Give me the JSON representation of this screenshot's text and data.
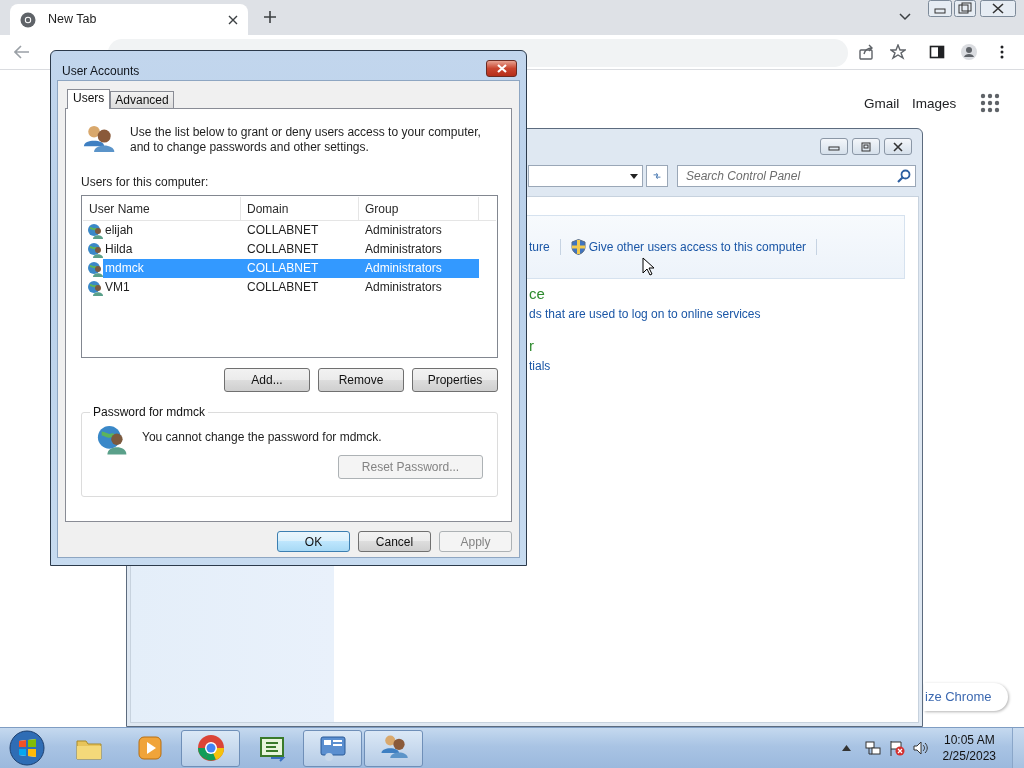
{
  "browser": {
    "tabs": [
      {
        "title": "New Tab",
        "selected": true
      }
    ],
    "page_links": [
      "Gmail",
      "Images"
    ],
    "customize_button": "ize Chrome"
  },
  "control_panel": {
    "search": {
      "placeholder": "Search Control Panel"
    },
    "tasks": [
      {
        "label": "ture",
        "kind": "link"
      },
      {
        "label": "Give other users access to this computer",
        "kind": "shield"
      }
    ],
    "sections": [
      {
        "heading": "ce",
        "link": "ds that are used to log on to online services"
      },
      {
        "heading": "r",
        "link": "tials"
      }
    ]
  },
  "dialog": {
    "title": "User Accounts",
    "tabs": [
      {
        "label": "Users",
        "selected": true
      },
      {
        "label": "Advanced",
        "selected": false
      }
    ],
    "intro": "Use the list below to grant or deny users access to your computer, and to change passwords and other settings.",
    "list_label": "Users for this computer:",
    "table": {
      "columns": [
        "User Name",
        "Domain",
        "Group"
      ],
      "rows": [
        {
          "cells": [
            "elijah",
            "COLLABNET",
            "Administrators"
          ],
          "selected": false
        },
        {
          "cells": [
            "Hilda",
            "COLLABNET",
            "Administrators"
          ],
          "selected": false
        },
        {
          "cells": [
            "mdmck",
            "COLLABNET",
            "Administrators"
          ],
          "selected": true
        },
        {
          "cells": [
            "VM1",
            "COLLABNET",
            "Administrators"
          ],
          "selected": false
        }
      ]
    },
    "list_buttons": [
      {
        "label": "Add...",
        "disabled": false
      },
      {
        "label": "Remove",
        "disabled": false
      },
      {
        "label": "Properties",
        "disabled": false
      }
    ],
    "password_group": {
      "title": "Password for mdmck",
      "message": "You cannot change the password for mdmck.",
      "button": {
        "label": "Reset Password...",
        "disabled": true
      }
    },
    "footer_buttons": [
      {
        "label": "OK",
        "disabled": false,
        "default": true
      },
      {
        "label": "Cancel",
        "disabled": false,
        "default": false
      },
      {
        "label": "Apply",
        "disabled": true,
        "default": false
      }
    ]
  },
  "taskbar": {
    "apps": [
      {
        "kind": "folder",
        "active": false
      },
      {
        "kind": "media",
        "active": false
      },
      {
        "kind": "browser",
        "active": true
      },
      {
        "kind": "code",
        "active": false
      },
      {
        "kind": "control",
        "active": true
      },
      {
        "kind": "users",
        "active": true
      }
    ],
    "clock": {
      "time": "10:05 AM",
      "date": "2/25/2023"
    }
  }
}
